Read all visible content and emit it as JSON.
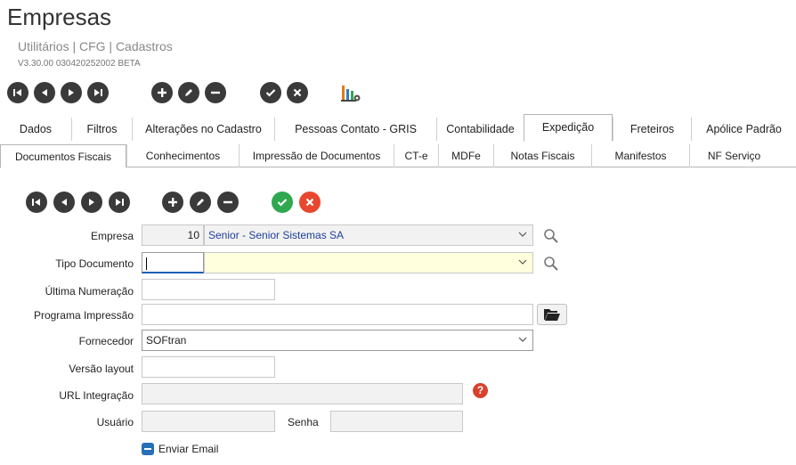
{
  "header": {
    "title": "Empresas",
    "breadcrumb": "Utilitários | CFG | Cadastros",
    "version": "V3.30.00 030420252002 BETA"
  },
  "tabs_main": [
    {
      "label": "Dados"
    },
    {
      "label": "Filtros"
    },
    {
      "label": "Alterações no Cadastro"
    },
    {
      "label": "Pessoas Contato - GRIS"
    },
    {
      "label": "Contabilidade"
    },
    {
      "label": "Expedição"
    },
    {
      "label": "Freteiros"
    },
    {
      "label": "Apólice Padrão"
    }
  ],
  "tabs_sub": [
    {
      "label": "Documentos Fiscais"
    },
    {
      "label": "Conhecimentos"
    },
    {
      "label": "Impressão de Documentos"
    },
    {
      "label": "CT-e"
    },
    {
      "label": "MDFe"
    },
    {
      "label": "Notas Fiscais"
    },
    {
      "label": "Manifestos"
    },
    {
      "label": "NF Serviço"
    }
  ],
  "form": {
    "empresa_label": "Empresa",
    "empresa_code": "10",
    "empresa_name": "Senior - Senior Sistemas SA",
    "tipo_documento_label": "Tipo Documento",
    "tipo_documento_code": "",
    "tipo_documento_value": "",
    "ultima_numeracao_label": "Última Numeração",
    "ultima_numeracao_value": "",
    "programa_impressao_label": "Programa Impressão",
    "programa_impressao_value": "",
    "fornecedor_label": "Fornecedor",
    "fornecedor_value": "SOFtran",
    "versao_layout_label": "Versão layout",
    "versao_layout_value": "",
    "url_integracao_label": "URL Integração",
    "url_integracao_value": "",
    "usuario_label": "Usuário",
    "usuario_value": "",
    "senha_label": "Senha",
    "senha_value": "",
    "enviar_email_label": "Enviar Email"
  },
  "icons": {
    "help": "?"
  },
  "colors": {
    "accent": "#1a5fb4",
    "confirm": "#2fa84f",
    "cancel": "#e8472f",
    "highlight_field": "#ffffdd"
  }
}
